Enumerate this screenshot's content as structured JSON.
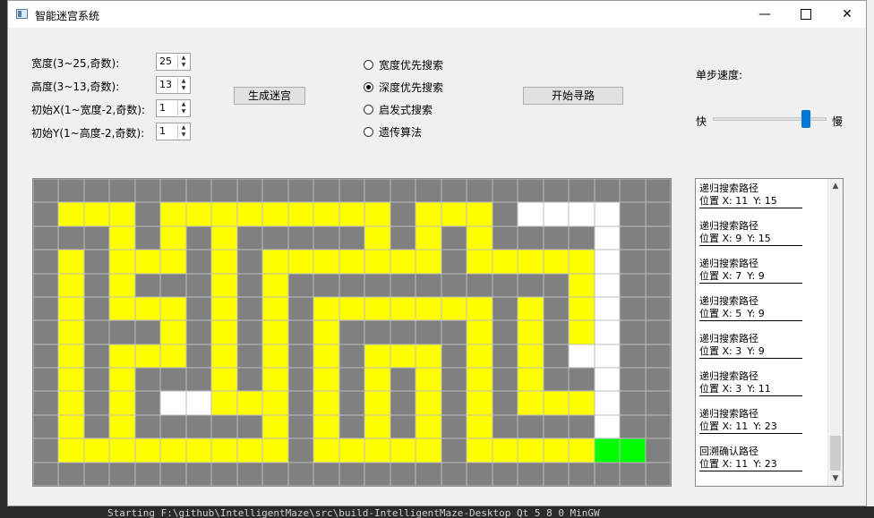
{
  "window": {
    "title": "智能迷宫系统"
  },
  "controls": {
    "width_label": "宽度(3~25,奇数):",
    "width_value": "25",
    "height_label": "高度(3~13,奇数):",
    "height_value": "13",
    "startx_label": "初始X(1~宽度-2,奇数):",
    "startx_value": "1",
    "starty_label": "初始Y(1~高度-2,奇数):",
    "starty_value": "1",
    "generate_button": "生成迷宫",
    "start_button": "开始寻路",
    "speed_label": "单步速度:",
    "speed_fast": "快",
    "speed_slow": "慢",
    "speed_position": 0.85
  },
  "algorithms": [
    {
      "label": "宽度优先搜索",
      "selected": false
    },
    {
      "label": "深度优先搜索",
      "selected": true
    },
    {
      "label": "启发式搜索",
      "selected": false
    },
    {
      "label": "遗传算法",
      "selected": false
    }
  ],
  "log": [
    {
      "title": "递归搜索路径",
      "pos": "位置 X: 11",
      "y": "Y: 15"
    },
    {
      "title": "递归搜索路径",
      "pos": "位置 X: 9",
      "y": "Y: 15"
    },
    {
      "title": "递归搜索路径",
      "pos": "位置 X: 7",
      "y": "Y: 9"
    },
    {
      "title": "递归搜索路径",
      "pos": "位置 X: 5",
      "y": "Y: 9"
    },
    {
      "title": "递归搜索路径",
      "pos": "位置 X: 3",
      "y": "Y: 9"
    },
    {
      "title": "递归搜索路径",
      "pos": "位置 X: 3",
      "y": "Y: 11"
    },
    {
      "title": "递归搜索路径",
      "pos": "位置 X: 11",
      "y": "Y: 23"
    },
    {
      "title": "回溯确认路径",
      "pos": "位置 X: 11",
      "y": "Y: 23"
    }
  ],
  "maze_legend": {
    "wall": "#808080",
    "visited": "#ffff00",
    "open": "#ffffff",
    "goal": "#00ff00"
  },
  "maze": [
    "0000000000000000000000000",
    "0111011111111101110222200",
    "0001010100000101010000200",
    "0101110101111111011111200",
    "0101000101000000000001200",
    "0101110101011111110101200",
    "0100010101010000010101200",
    "0101110101010111010102200",
    "0101000101010101010100200",
    "0101022111010101010111200",
    "0101000001010101010000200",
    "0111111111011111011111330",
    "0000000000000000000000000"
  ],
  "background_terminal": "Starting F:\\github\\IntelligentMaze\\src\\build-IntelligentMaze-Desktop_Qt_5_8_0_MinGW"
}
